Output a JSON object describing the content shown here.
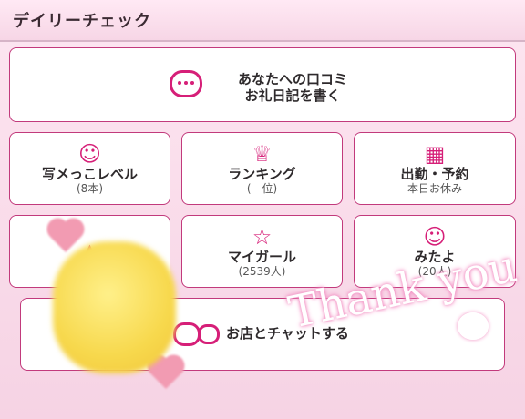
{
  "header": {
    "title": "デイリーチェック"
  },
  "top_card": {
    "line1": "あなたへの口コミ",
    "line2": "お礼日記を書く",
    "icon": "chat-bubble-icon"
  },
  "grid": [
    {
      "label": "写メっこレベル",
      "sub": "(8本)",
      "icon": "angel-icon"
    },
    {
      "label": "ランキング",
      "sub": "( - 位)",
      "icon": "crown-icon"
    },
    {
      "label": "出勤・予約",
      "sub": "本日お休み",
      "icon": "calendar-icon"
    },
    {
      "label": "",
      "sub": "",
      "icon": "chart-icon"
    },
    {
      "label": "マイガール",
      "sub": "(2539人)",
      "icon": "star-icon"
    },
    {
      "label": "みたよ",
      "sub": "(20人)",
      "icon": "smile-icon"
    }
  ],
  "chat_card": {
    "label": "お店とチャットする"
  },
  "sticker": {
    "text": "Thank you"
  }
}
